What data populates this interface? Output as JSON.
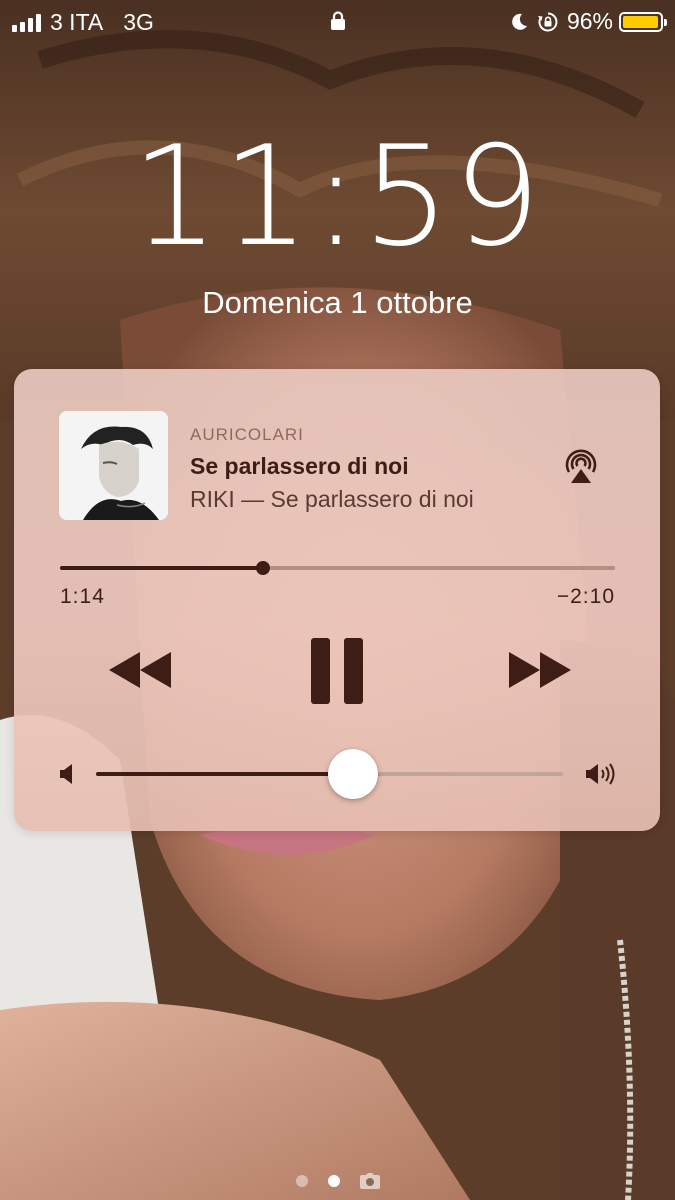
{
  "status_bar": {
    "carrier": "3 ITA",
    "network": "3G",
    "battery_percent": "96%",
    "battery_level": 0.96,
    "signal_bars": 4,
    "icons": [
      "signal-icon",
      "lock-icon",
      "moon-icon",
      "rotation-lock-icon",
      "battery-icon"
    ]
  },
  "lock_screen": {
    "time": "11:59",
    "date": "Domenica 1 ottobre"
  },
  "now_playing": {
    "route": "AURICOLARI",
    "title": "Se parlassero di noi",
    "subtitle": "RIKI — Se parlassero di noi",
    "elapsed": "1:14",
    "remaining": "−2:10",
    "progress": 0.366,
    "volume": 0.55,
    "state": "playing",
    "icons": [
      "airplay-icon",
      "rewind-icon",
      "pause-icon",
      "fast-forward-icon",
      "volume-min-icon",
      "volume-max-icon"
    ]
  },
  "page_indicator": {
    "pages": 2,
    "active_index": 1,
    "camera_icon": "camera-icon"
  },
  "colors": {
    "card_text": "#3d1d15",
    "battery_fill": "#ffcc00"
  }
}
